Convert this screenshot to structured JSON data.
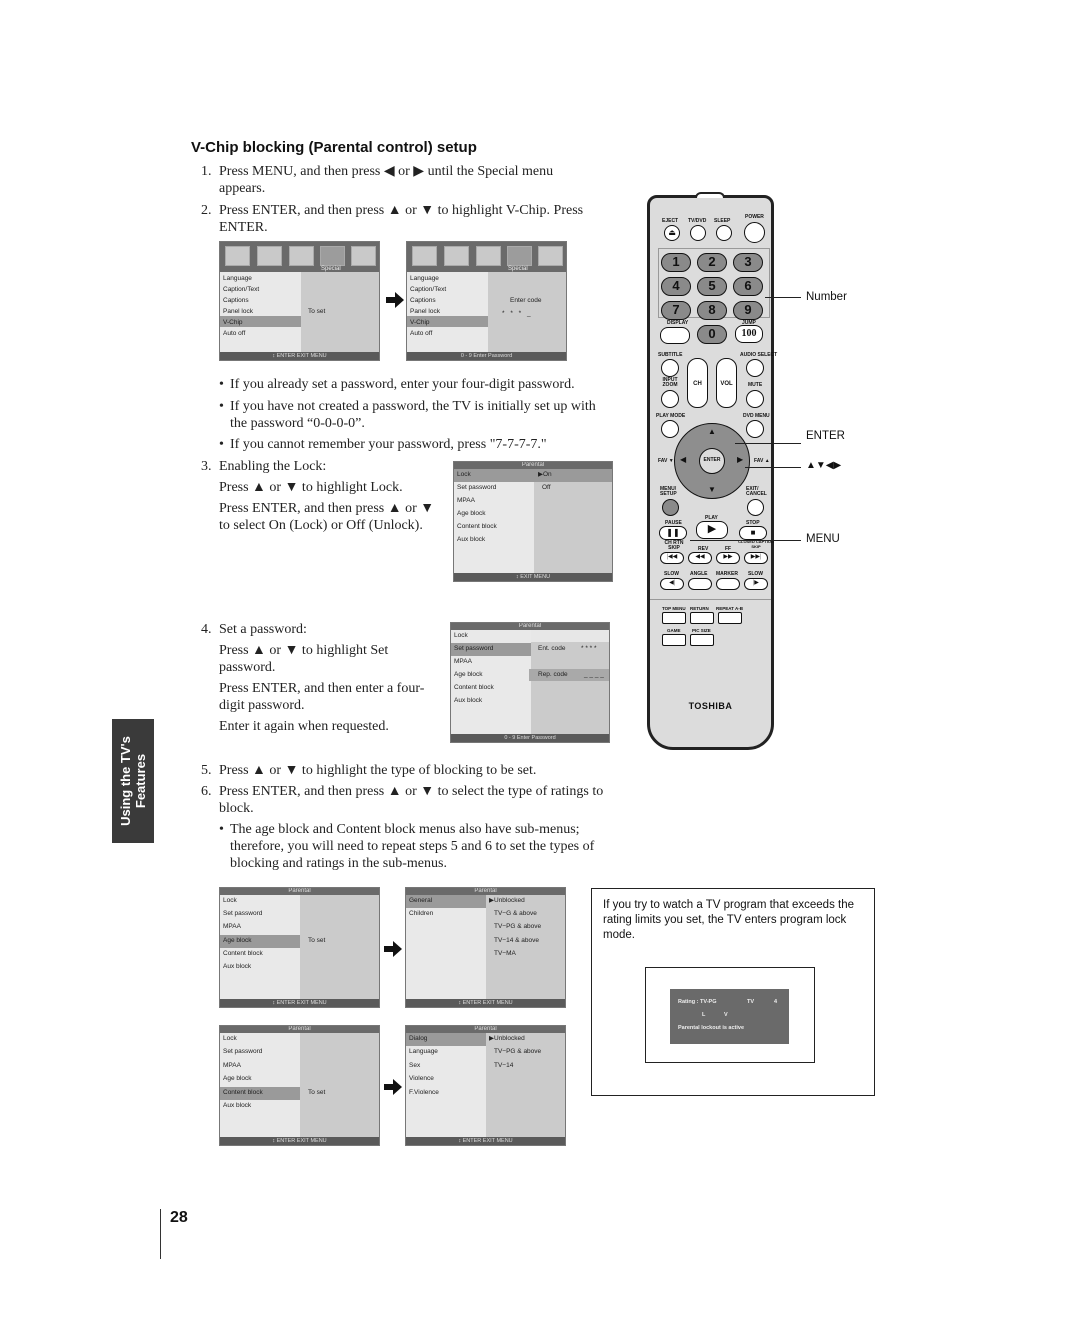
{
  "heading": "V-Chip blocking (Parental control) setup",
  "side_tab": {
    "line1": "Using the TV's",
    "line2": "Features"
  },
  "page_number": "28",
  "steps": [
    {
      "num": "1.",
      "text": "Press MENU, and then press ◀ or ▶ until the Special menu appears."
    },
    {
      "num": "2.",
      "text": "Press ENTER, and then press ▲ or ▼ to highlight V-Chip. Press ENTER."
    },
    {
      "num": "3.",
      "title": "Enabling the Lock:",
      "lines": [
        "Press ▲ or ▼ to highlight Lock.",
        "Press ENTER, and then press ▲ or ▼ to select On (Lock) or Off (Unlock)."
      ]
    },
    {
      "num": "4.",
      "title": "Set a password:",
      "lines": [
        "Press ▲ or ▼ to highlight Set password.",
        "Press ENTER, and then enter a four-digit password.",
        "Enter it again when requested."
      ]
    },
    {
      "num": "5.",
      "text": "Press ▲ or ▼ to highlight the type of blocking to be set."
    },
    {
      "num": "6.",
      "text": "Press ENTER, and then press ▲ or ▼ to select the type of ratings to block."
    }
  ],
  "bullets_step2": [
    "If you already set a password, enter your four-digit password.",
    "If you have not created a password, the TV is initially set up with the password “0-0-0-0”.",
    "If you cannot remember your password, press \"7-7-7-7.\""
  ],
  "bullet_step6": "The age block and Content block menus also have sub-menus; therefore, you will need to repeat steps 5 and 6 to set the types of blocking and ratings in the sub-menus.",
  "special_menu": {
    "icon_label": "Special",
    "items": [
      "Language",
      "Caption/Text",
      "Captions",
      "Panel lock",
      "V-Chip",
      "Auto off"
    ],
    "value_a": "To set",
    "footer_a": "↕ ENTER EXIT MENU",
    "value_b": "Enter code",
    "code_b": "*  *  *  _",
    "footer_b": "0 - 9  Enter  Password"
  },
  "parental_menu": {
    "title": "Parental",
    "items": [
      "Lock",
      "Set password",
      "MPAA",
      "Age block",
      "Content block",
      "Aux block"
    ],
    "lock_on": "▶On",
    "lock_off": "Off",
    "footer_exit": "↕ EXIT MENU",
    "footer_enter": "↕ ENTER EXIT MENU",
    "footer_password": "0 - 9  Enter  Password",
    "ent_code_label": "Ent. code",
    "ent_code_value": "* * * *",
    "rep_code_label": "Rep. code",
    "rep_code_value": "_ _ _ _",
    "to_set": "To set"
  },
  "age_submenu": {
    "items": [
      "General",
      "Children"
    ],
    "values": [
      "▶Unblocked",
      "TV−G & above",
      "TV−PG & above",
      "TV−14 & above",
      "TV−MA"
    ]
  },
  "content_submenu": {
    "items": [
      "Dialog",
      "Language",
      "Sex",
      "Violence",
      "F.Violence"
    ],
    "values": [
      "▶Unblocked",
      "TV−PG & above",
      "TV−14"
    ]
  },
  "info_box": {
    "text": "If you try to watch a TV program that exceeds the rating limits you set, the TV enters program lock mode.",
    "osd_rating": "Rating : TV-PG",
    "osd_tv": "TV",
    "osd_ch": "4",
    "osd_l": "L",
    "osd_v": "V",
    "osd_msg": "Parental lockout is active"
  },
  "remote": {
    "brand": "TOSHIBA",
    "top_labels": [
      "EJECT",
      "TV/DVD",
      "SLEEP",
      "POWER"
    ],
    "digits": [
      "1",
      "2",
      "3",
      "4",
      "5",
      "6",
      "7",
      "8",
      "9",
      "0"
    ],
    "display_label": "DISPLAY",
    "jump_label": "JUMP",
    "jump_value": "100",
    "subtitle": "SUBTITLE",
    "audio_select": "AUDIO SELECT",
    "input_zoom": "INPUT ZOOM",
    "ch": "CH",
    "vol": "VOL",
    "mute": "MUTE",
    "play_mode": "PLAY MODE",
    "dvd_menu": "DVD MENU",
    "fav_down": "FAV ▼",
    "fav_up": "FAV ▲",
    "enter": "ENTER",
    "menu_setup": "MENU/ SETUP",
    "exit_cancel": "EXIT/ CANCEL",
    "pause": "PAUSE",
    "play": "PLAY",
    "stop": "STOP",
    "ch_rtn_skip": "CH RTN SKIP",
    "rev": "REV",
    "ff": "FF",
    "cc_skip": "CLOSED CAPTION SKIP",
    "slow1": "SLOW",
    "angle": "ANGLE",
    "marker": "MARKER",
    "slow2": "SLOW",
    "top_menu": "TOP MENU",
    "return": "RETURN",
    "repeat": "REPEAT A-B",
    "game": "GAME",
    "pic_size": "PIC SIZE"
  },
  "callouts": {
    "number": "Number",
    "enter": "ENTER",
    "arrows": "▲▼◀▶",
    "menu": "MENU"
  }
}
